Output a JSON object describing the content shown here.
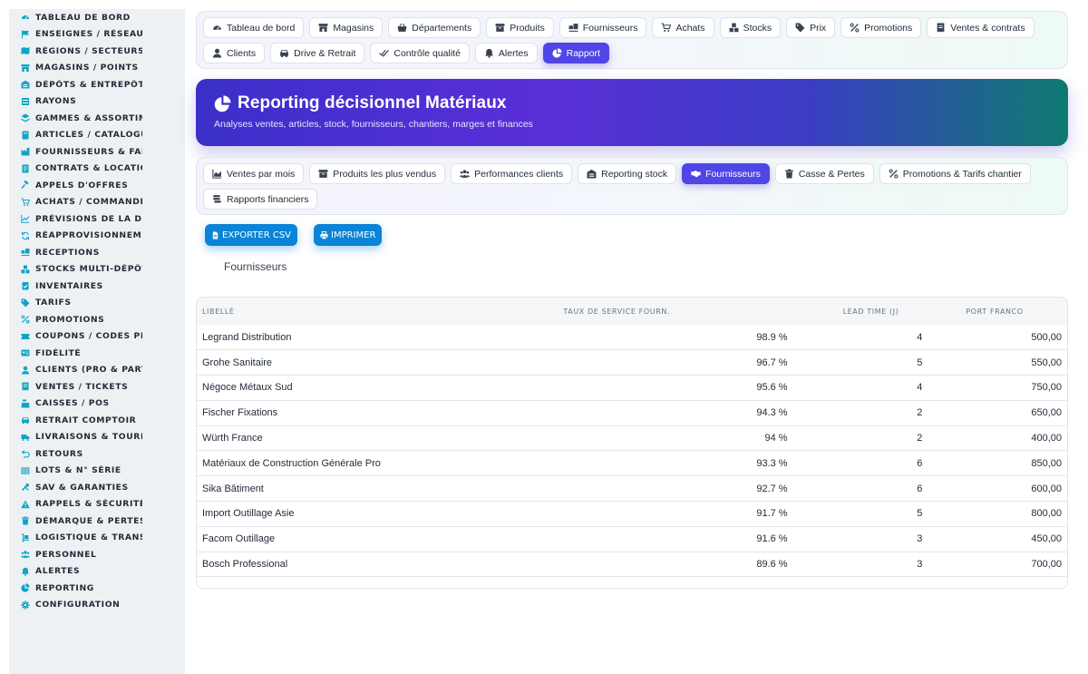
{
  "sidebar": {
    "items": [
      {
        "label": "TABLEAU DE BORD",
        "icon": "gauge-icon"
      },
      {
        "label": "ENSEIGNES / RÉSEAU",
        "icon": "flag-icon"
      },
      {
        "label": "RÉGIONS / SECTEURS",
        "icon": "map-icon"
      },
      {
        "label": "MAGASINS / POINTS DE VENTE",
        "icon": "store-icon"
      },
      {
        "label": "DÉPÔTS & ENTREPÔTS",
        "icon": "warehouse-icon"
      },
      {
        "label": "RAYONS",
        "icon": "shelf-icon"
      },
      {
        "label": "GAMMES & ASSORTIMENTS",
        "icon": "layers-icon"
      },
      {
        "label": "ARTICLES / CATALOGUE",
        "icon": "book-icon"
      },
      {
        "label": "FOURNISSEURS & FABRICANTS",
        "icon": "factory-icon"
      },
      {
        "label": "CONTRATS & LOCATION",
        "icon": "contract-icon"
      },
      {
        "label": "APPELS D'OFFRES",
        "icon": "gavel-icon"
      },
      {
        "label": "ACHATS / COMMANDES FOURNISSEURS",
        "icon": "cart-icon"
      },
      {
        "label": "PRÉVISIONS DE LA DEMANDE",
        "icon": "chart-line-icon"
      },
      {
        "label": "RÉAPPROVISIONNEMENT",
        "icon": "sync-icon"
      },
      {
        "label": "RÉCEPTIONS",
        "icon": "truck-ramp-icon"
      },
      {
        "label": "STOCKS MULTI-DÉPÔTS",
        "icon": "boxes-icon"
      },
      {
        "label": "INVENTAIRES",
        "icon": "clipboard-check-icon"
      },
      {
        "label": "TARIFS",
        "icon": "tags-icon"
      },
      {
        "label": "PROMOTIONS",
        "icon": "percent-icon"
      },
      {
        "label": "COUPONS / CODES PROMO",
        "icon": "ticket-icon"
      },
      {
        "label": "FIDÉLITÉ",
        "icon": "id-card-icon"
      },
      {
        "label": "CLIENTS (PRO & PARTICULIERS)",
        "icon": "user-icon"
      },
      {
        "label": "VENTES / TICKETS",
        "icon": "receipt-icon"
      },
      {
        "label": "CAISSES / POS",
        "icon": "cash-register-icon"
      },
      {
        "label": "RETRAIT COMPTOIR",
        "icon": "car-icon"
      },
      {
        "label": "LIVRAISONS & TOURNÉES",
        "icon": "truck-icon"
      },
      {
        "label": "RETOURS",
        "icon": "undo-icon"
      },
      {
        "label": "LOTS & N° SÉRIE",
        "icon": "barcode-icon"
      },
      {
        "label": "SAV & GARANTIES",
        "icon": "tools-icon"
      },
      {
        "label": "RAPPELS & SÉCURITÉ",
        "icon": "warning-icon"
      },
      {
        "label": "DÉMARQUE & PERTES",
        "icon": "trash-icon"
      },
      {
        "label": "LOGISTIQUE & TRANSPORT",
        "icon": "dolly-icon"
      },
      {
        "label": "PERSONNEL",
        "icon": "users-icon"
      },
      {
        "label": "ALERTES",
        "icon": "bell-icon"
      },
      {
        "label": "REPORTING",
        "icon": "pie-chart-icon"
      },
      {
        "label": "CONFIGURATION",
        "icon": "gear-icon"
      }
    ]
  },
  "topnav": {
    "items": [
      {
        "label": "Tableau de bord",
        "icon": "gauge-icon",
        "active": false
      },
      {
        "label": "Magasins",
        "icon": "store-icon",
        "active": false
      },
      {
        "label": "Départements",
        "icon": "basket-icon",
        "active": false
      },
      {
        "label": "Produits",
        "icon": "box-icon",
        "active": false
      },
      {
        "label": "Fournisseurs",
        "icon": "truck-ramp-icon",
        "active": false
      },
      {
        "label": "Achats",
        "icon": "cart-icon",
        "active": false
      },
      {
        "label": "Stocks",
        "icon": "boxes-icon",
        "active": false
      },
      {
        "label": "Prix",
        "icon": "tags-icon",
        "active": false
      },
      {
        "label": "Promotions",
        "icon": "percent-icon",
        "active": false
      },
      {
        "label": "Ventes & contrats",
        "icon": "receipt-icon",
        "active": false
      },
      {
        "label": "Clients",
        "icon": "user-icon",
        "active": false
      },
      {
        "label": "Drive & Retrait",
        "icon": "car-icon",
        "active": false
      },
      {
        "label": "Contrôle qualité",
        "icon": "check-double-icon",
        "active": false
      },
      {
        "label": "Alertes",
        "icon": "bell-icon",
        "active": false
      },
      {
        "label": "Rapport",
        "icon": "pie-chart-icon",
        "active": true
      }
    ]
  },
  "hero": {
    "title": "Reporting décisionnel Matériaux",
    "subtitle": "Analyses ventes, articles, stock, fournisseurs, chantiers, marges et finances",
    "icon": "pie-chart-icon"
  },
  "report_tabs": {
    "items": [
      {
        "label": "Ventes par mois",
        "icon": "chart-area-icon",
        "active": false
      },
      {
        "label": "Produits les plus vendus",
        "icon": "box-icon",
        "active": false
      },
      {
        "label": "Performances clients",
        "icon": "users-icon",
        "active": false
      },
      {
        "label": "Reporting stock",
        "icon": "warehouse-icon",
        "active": false
      },
      {
        "label": "Fournisseurs",
        "icon": "handshake-icon",
        "active": true
      },
      {
        "label": "Casse & Pertes",
        "icon": "trash-icon",
        "active": false
      },
      {
        "label": "Promotions & Tarifs chantier",
        "icon": "percent-icon",
        "active": false
      },
      {
        "label": "Rapports financiers",
        "icon": "coins-icon",
        "active": false
      }
    ]
  },
  "actions": {
    "export_label": "EXPORTER CSV",
    "print_label": "IMPRIMER"
  },
  "section_title": "Fournisseurs",
  "table": {
    "columns": [
      "LIBELLÉ",
      "TAUX DE SERVICE FOURN.",
      "LEAD TIME (J)",
      "PORT FRANCO"
    ],
    "rows": [
      [
        "Legrand Distribution",
        "98.9 %",
        "4",
        "500,00"
      ],
      [
        "Grohe Sanitaire",
        "96.7 %",
        "5",
        "550,00"
      ],
      [
        "Négoce Métaux Sud",
        "95.6 %",
        "4",
        "750,00"
      ],
      [
        "Fischer Fixations",
        "94.3 %",
        "2",
        "650,00"
      ],
      [
        "Würth France",
        "94 %",
        "2",
        "400,00"
      ],
      [
        "Matériaux de Construction Générale Pro",
        "93.3 %",
        "6",
        "850,00"
      ],
      [
        "Sika Bâtiment",
        "92.7 %",
        "6",
        "600,00"
      ],
      [
        "Import Outillage Asie",
        "91.7 %",
        "5",
        "800,00"
      ],
      [
        "Facom Outillage",
        "91.6 %",
        "3",
        "450,00"
      ],
      [
        "Bosch Professional",
        "89.6 %",
        "3",
        "700,00"
      ]
    ]
  },
  "colors": {
    "accent": "#4f46e5",
    "action_blue": "#0a84d6",
    "sidebar_icon": "#0ea5c4",
    "hero_start": "#3b2fc9",
    "hero_end": "#0f7a70"
  }
}
